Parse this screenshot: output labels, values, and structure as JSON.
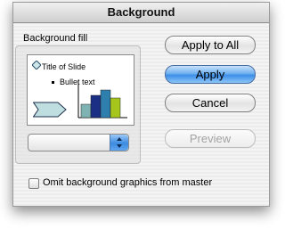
{
  "dialog": {
    "title": "Background",
    "fill_label": "Background fill",
    "preview": {
      "slide_title": "Title of Slide",
      "bullet_text": "Bullet text",
      "bar_colors": [
        "#7fb2b3",
        "#1b2f85",
        "#2f7fae",
        "#a6c61b"
      ],
      "arrow_color": "#bfdedf"
    },
    "fill_popup": {
      "value": "",
      "arrow_icon": "up-down-arrows-icon"
    },
    "buttons": {
      "apply_to_all": "Apply to All",
      "apply": "Apply",
      "cancel": "Cancel",
      "preview": "Preview"
    },
    "checkbox": {
      "label": "Omit background graphics from master",
      "checked": false
    }
  }
}
